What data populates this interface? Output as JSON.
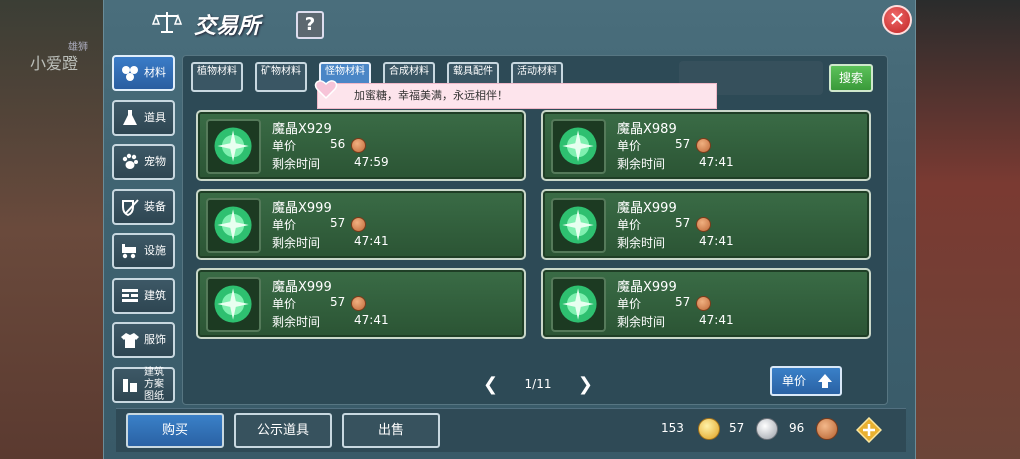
{
  "background": {
    "watermark": "小爱蹬",
    "watermark_small": "雄狮"
  },
  "header": {
    "title": "交易所",
    "help_label": "?",
    "close_label": "✕"
  },
  "sidebar": {
    "items": [
      {
        "label": "材料",
        "icon": "cubes-icon",
        "active": true
      },
      {
        "label": "道具",
        "icon": "flask-icon",
        "active": false
      },
      {
        "label": "宠物",
        "icon": "paw-icon",
        "active": false
      },
      {
        "label": "装备",
        "icon": "sword-shield-icon",
        "active": false
      },
      {
        "label": "设施",
        "icon": "wagon-icon",
        "active": false
      },
      {
        "label": "建筑",
        "icon": "brick-wall-icon",
        "active": false
      },
      {
        "label": "服饰",
        "icon": "shirt-icon",
        "active": false
      },
      {
        "label": "建筑方案图纸",
        "icon": "blueprint-icon",
        "active": false
      }
    ]
  },
  "tabs": [
    {
      "label": "植物材料",
      "active": false
    },
    {
      "label": "矿物材料",
      "active": false
    },
    {
      "label": "怪物材料",
      "active": true
    },
    {
      "label": "合成材料",
      "active": false
    },
    {
      "label": "载具配件",
      "active": false
    },
    {
      "label": "活动材料",
      "active": false
    }
  ],
  "search": {
    "value": "",
    "placeholder": "",
    "button_label": "搜索"
  },
  "toast": {
    "text": "加蜜糖，幸福美满，永远相伴！"
  },
  "listings": [
    {
      "name": "魔晶X929",
      "price_label": "单价",
      "price": "56",
      "time_label": "剩余时间",
      "time": "47:59"
    },
    {
      "name": "魔晶X989",
      "price_label": "单价",
      "price": "57",
      "time_label": "剩余时间",
      "time": "47:41"
    },
    {
      "name": "魔晶X999",
      "price_label": "单价",
      "price": "57",
      "time_label": "剩余时间",
      "time": "47:41"
    },
    {
      "name": "魔晶X999",
      "price_label": "单价",
      "price": "57",
      "time_label": "剩余时间",
      "time": "47:41"
    },
    {
      "name": "魔晶X999",
      "price_label": "单价",
      "price": "57",
      "time_label": "剩余时间",
      "time": "47:41"
    },
    {
      "name": "魔晶X999",
      "price_label": "单价",
      "price": "57",
      "time_label": "剩余时间",
      "time": "47:41"
    }
  ],
  "pager": {
    "current": "1/11"
  },
  "sort": {
    "label": "单价"
  },
  "bottom": {
    "buy_label": "购买",
    "showcase_label": "公示道具",
    "sell_label": "出售"
  },
  "currencies": {
    "gold": "153",
    "silver": "57",
    "bronze": "96"
  },
  "colors": {
    "gold": "#f2c14a",
    "silver": "#c8ccd2",
    "bronze": "#d08050",
    "accent_blue": "#3a80c8",
    "card_green": "#3a6c46"
  }
}
